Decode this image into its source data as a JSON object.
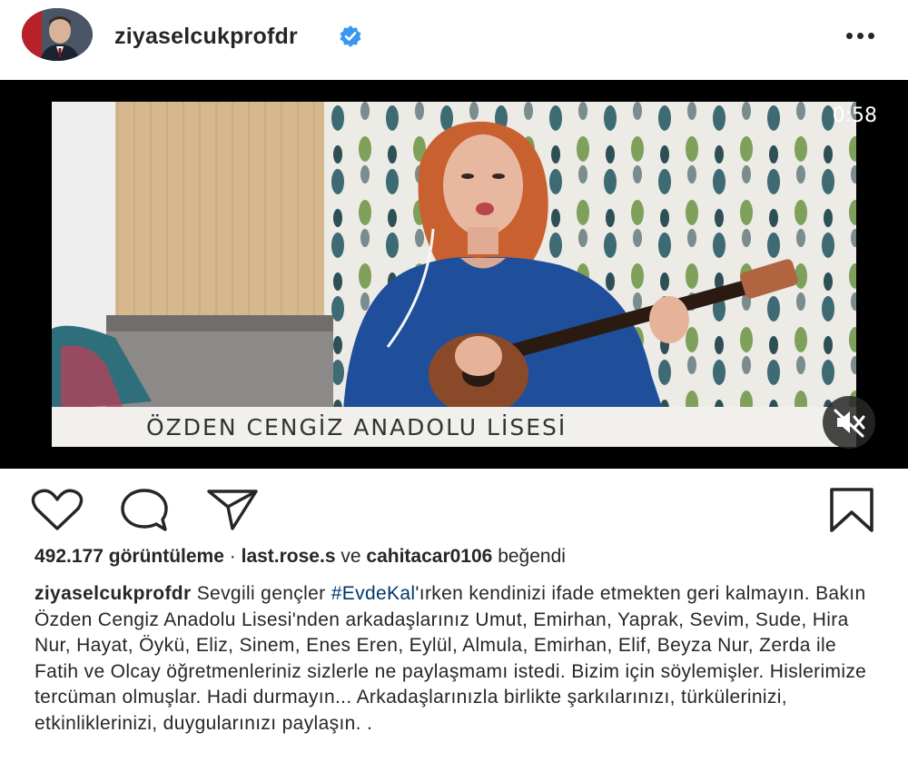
{
  "header": {
    "username": "ziyaselcukprofdr",
    "verified_icon": "verified-badge-icon",
    "more_icon": "more-options-icon"
  },
  "video": {
    "duration": "0:58",
    "overlay_caption": "ÖZDEN CENGİZ ANADOLU LİSESİ",
    "mute_icon": "speaker-muted-icon"
  },
  "actions": {
    "icons": [
      "heart-icon",
      "comment-icon",
      "share-icon",
      "bookmark-icon"
    ]
  },
  "stats": {
    "views": "492.177 görüntüleme",
    "separator": "·",
    "liker1": "last.rose.s",
    "conjunction": "ve",
    "liker2": "cahitacar0106",
    "liked_word": "beğendi"
  },
  "caption": {
    "username": "ziyaselcukprofdr",
    "text_before_tag": "Sevgili gençler",
    "hashtag": "#EvdeKal",
    "text_after_tag": "'ırken kendinizi ifade etmekten geri kalmayın. Bakın Özden Cengiz Anadolu Lisesi'nden arkadaşlarınız Umut, Emirhan, Yaprak, Sevim, Sude, Hira Nur, Hayat, Öykü, Eliz, Sinem, Enes Eren, Eylül, Almula, Emirhan, Elif, Beyza Nur, Zerda ile Fatih ve Olcay öğretmenleriniz sizlerle ne paylaşmamı istedi. Bizim için söylemişler. Hislerimize tercüman olmuşlar. Hadi durmayın... Arkadaşlarınızla birlikte şarkılarınızı, türkülerinizi, etkinliklerinizi, duygularınızı paylaşın. ."
  },
  "colors": {
    "text": "#262626",
    "hashtag": "#00376b",
    "verified": "#3897f0",
    "sweater": "#1f4f9a",
    "hair": "#c8602f"
  }
}
